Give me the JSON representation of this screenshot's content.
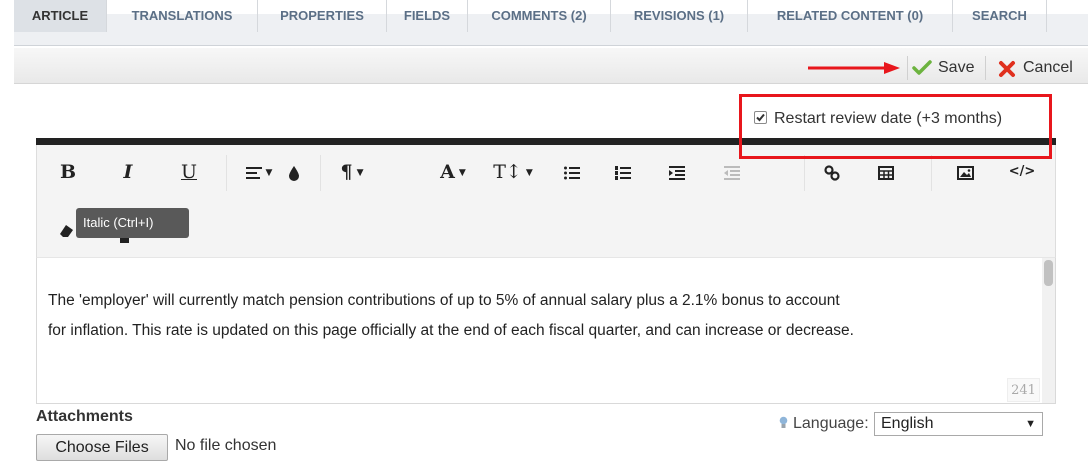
{
  "tabs": [
    {
      "label": "ARTICLE",
      "active": true
    },
    {
      "label": "TRANSLATIONS"
    },
    {
      "label": "PROPERTIES"
    },
    {
      "label": "FIELDS"
    },
    {
      "label": "COMMENTS (2)"
    },
    {
      "label": "REVISIONS (1)"
    },
    {
      "label": "RELATED CONTENT (0)"
    },
    {
      "label": "SEARCH"
    }
  ],
  "toolbar": {
    "save_label": "Save",
    "cancel_label": "Cancel",
    "save_icon": "checkmark-icon",
    "cancel_icon": "x-icon"
  },
  "review": {
    "checked": true,
    "label": "Restart review date (+3 months)"
  },
  "editor": {
    "buttons": [
      "bold",
      "italic",
      "underline",
      "align",
      "color",
      "paragraph",
      "font",
      "font-size",
      "unordered-list",
      "ordered-list",
      "indent",
      "outdent",
      "link",
      "table",
      "image",
      "code",
      "eraser"
    ],
    "tooltip": "Italic (Ctrl+I)",
    "body_lines": [
      "The 'employer' will currently match pension contributions of up to 5% of annual salary plus a 2.1% bonus to account",
      "for inflation. This rate is updated on this page officially at the end of  each fiscal quarter, and can increase or decrease."
    ],
    "word_count": "241"
  },
  "attachments": {
    "label": "Attachments",
    "button": "Choose Files",
    "status": "No file chosen"
  },
  "language": {
    "label": "Language:",
    "value": "English"
  },
  "colors": {
    "highlight": "#e8161c",
    "tab_text": "#5b6f86",
    "save_green": "#6cb33f",
    "cancel_red": "#e0301e"
  }
}
